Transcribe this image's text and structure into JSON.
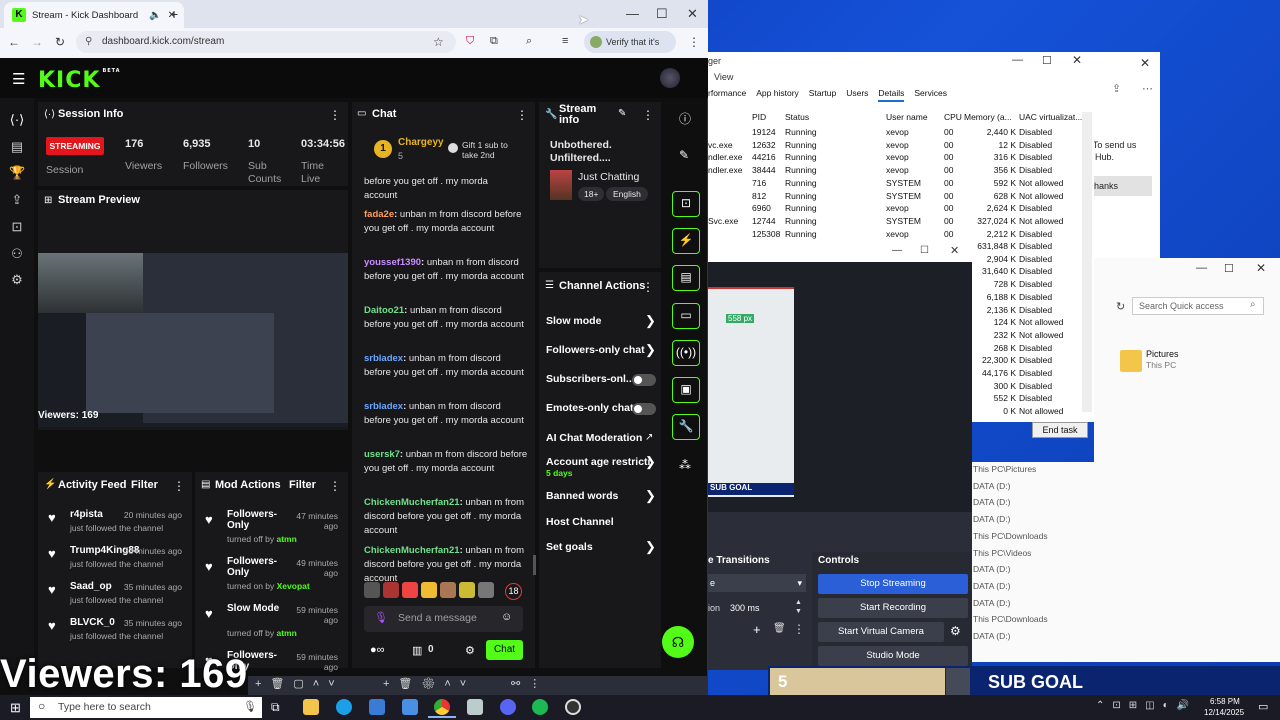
{
  "browser": {
    "tab_title": "Stream - Kick Dashboard",
    "url": "dashboard.kick.com/stream",
    "verify_label": "Verify that it's you"
  },
  "kick": {
    "logo": "KICK",
    "logo_sup": "BETA",
    "session": {
      "title": "Session Info",
      "status_badge": "STREAMING",
      "status_label": "Session",
      "viewers_value": "176",
      "viewers_label": "Viewers",
      "followers_value": "6,935",
      "followers_label": "Followers",
      "subs_value": "10",
      "subs_label": "Sub Counts",
      "time_value": "03:34:56",
      "time_label": "Time Live"
    },
    "preview": {
      "title": "Stream Preview",
      "viewers_overlay": "Viewers: 169"
    },
    "chat": {
      "title": "Chat",
      "top_user": "Chargeyy",
      "top_badge": "1",
      "top_count": "5",
      "gift_text": "Gift 1 sub to take 2nd",
      "partial_line_1": "before you get off . my morda",
      "partial_line_2": "account",
      "messages": [
        {
          "user": "fada2e",
          "text": "unban m from discord before you get off . my morda account",
          "color": "#ff9d5c"
        },
        {
          "user": "youssef1390",
          "text": "unban m from discord before you get off . my morda account",
          "color": "#c98cff"
        },
        {
          "user": "Daitoo21",
          "text": "unban m from discord before you get off . my morda account",
          "color": "#6fe08a"
        },
        {
          "user": "srbladex",
          "text": "unban m from discord before you get off . my morda account",
          "color": "#6aa8ff"
        },
        {
          "user": "srbladex",
          "text": "unban m from discord before you get off . my morda account",
          "color": "#6aa8ff"
        },
        {
          "user": "usersk7",
          "text": "unban m from discord before you get off . my morda account",
          "color": "#6fe08a"
        },
        {
          "user": "ChickenMucherfan21",
          "text": "unban m from discord before you get off . my morda account",
          "color": "#6fe08a"
        },
        {
          "user": "ChickenMucherfan21",
          "text": "unban m from discord before you get off . my morda account",
          "color": "#6fe08a"
        }
      ],
      "emote_count": "18",
      "input_placeholder": "Send a message",
      "points": "0",
      "send_label": "Chat"
    },
    "stream_info": {
      "title": "Stream info",
      "stream_title": "Unbothered. Unfiltered....",
      "category": "Just Chatting",
      "tag_age": "18+",
      "tag_lang": "English"
    },
    "channel_actions": {
      "title": "Channel Actions",
      "items": [
        {
          "label": "Slow mode",
          "kind": "chevron"
        },
        {
          "label": "Followers-only chat",
          "kind": "chevron"
        },
        {
          "label": "Subscribers-onl...",
          "kind": "toggle"
        },
        {
          "label": "Emotes-only chat",
          "kind": "toggle"
        },
        {
          "label": "AI Chat Moderation",
          "kind": "external"
        },
        {
          "label": "Account age restricti",
          "kind": "chevron",
          "sub": "5 days"
        },
        {
          "label": "Banned words",
          "kind": "chevron"
        },
        {
          "label": "Host Channel",
          "kind": "none"
        },
        {
          "label": "Set goals",
          "kind": "chevron"
        }
      ]
    },
    "activity_feed": {
      "title": "Activity Feed",
      "filter_label": "Filter",
      "items": [
        {
          "user": "r4pista",
          "time": "20 minutes ago",
          "action": "just followed the channel"
        },
        {
          "user": "Trump4King88",
          "time": "33 minutes ago",
          "action": "just followed the channel"
        },
        {
          "user": "Saad_op",
          "time": "35 minutes ago",
          "action": "just followed the channel"
        },
        {
          "user": "BLVCK_0",
          "time": "35 minutes ago",
          "action": "just followed the channel"
        }
      ]
    },
    "mod_actions": {
      "title": "Mod Actions",
      "filter_label": "Filter",
      "items": [
        {
          "title": "Followers-Only",
          "time": "47 minutes ago",
          "action": "turned off by",
          "by": "atmn"
        },
        {
          "title": "Followers-Only",
          "time": "49 minutes ago",
          "action": "turned on by",
          "by": "Xevopat"
        },
        {
          "title": "Slow Mode",
          "time": "59 minutes ago",
          "action": "turned off by",
          "by": "atmn"
        },
        {
          "title": "Followers-Only",
          "time": "59 minutes ago",
          "action": "",
          "by": ""
        }
      ]
    }
  },
  "task_manager": {
    "menu_view": "View",
    "tabs": [
      "rformance",
      "App history",
      "Startup",
      "Users",
      "Details",
      "Services"
    ],
    "columns": [
      "PID",
      "Status",
      "User name",
      "CPU",
      "Memory (a...",
      "UAC virtualizat..."
    ],
    "rows": [
      {
        "name": "",
        "pid": "19124",
        "status": "Running",
        "user": "xevop",
        "cpu": "00",
        "mem": "2,440 K",
        "uac": "Disabled"
      },
      {
        "name": "vc.exe",
        "pid": "12632",
        "status": "Running",
        "user": "xevop",
        "cpu": "00",
        "mem": "12 K",
        "uac": "Disabled"
      },
      {
        "name": "ndler.exe",
        "pid": "44216",
        "status": "Running",
        "user": "xevop",
        "cpu": "00",
        "mem": "316 K",
        "uac": "Disabled"
      },
      {
        "name": "ndler.exe",
        "pid": "38444",
        "status": "Running",
        "user": "xevop",
        "cpu": "00",
        "mem": "356 K",
        "uac": "Disabled"
      },
      {
        "name": "",
        "pid": "716",
        "status": "Running",
        "user": "SYSTEM",
        "cpu": "00",
        "mem": "592 K",
        "uac": "Not allowed"
      },
      {
        "name": "",
        "pid": "812",
        "status": "Running",
        "user": "SYSTEM",
        "cpu": "00",
        "mem": "628 K",
        "uac": "Not allowed"
      },
      {
        "name": "",
        "pid": "6960",
        "status": "Running",
        "user": "xevop",
        "cpu": "00",
        "mem": "2,624 K",
        "uac": "Disabled"
      },
      {
        "name": "Svc.exe",
        "pid": "12744",
        "status": "Running",
        "user": "SYSTEM",
        "cpu": "00",
        "mem": "327,024 K",
        "uac": "Not allowed"
      },
      {
        "name": "",
        "pid": "125308",
        "status": "Running",
        "user": "xevop",
        "cpu": "00",
        "mem": "2,212 K",
        "uac": "Disabled"
      }
    ],
    "extra_rows": [
      {
        "mem": "631,848 K",
        "uac": "Disabled"
      },
      {
        "mem": "2,904 K",
        "uac": "Disabled"
      },
      {
        "mem": "31,640 K",
        "uac": "Disabled"
      },
      {
        "mem": "728 K",
        "uac": "Disabled"
      },
      {
        "mem": "6,188 K",
        "uac": "Disabled"
      },
      {
        "mem": "2,136 K",
        "uac": "Disabled"
      },
      {
        "mem": "124 K",
        "uac": "Not allowed"
      },
      {
        "mem": "232 K",
        "uac": "Not allowed"
      },
      {
        "mem": "268 K",
        "uac": "Disabled"
      },
      {
        "mem": "22,300 K",
        "uac": "Disabled"
      },
      {
        "mem": "44,176 K",
        "uac": "Disabled"
      },
      {
        "mem": "300 K",
        "uac": "Disabled"
      },
      {
        "mem": "552 K",
        "uac": "Disabled"
      },
      {
        "mem": "0 K",
        "uac": "Not allowed"
      }
    ],
    "end_task": "End task"
  },
  "notice": {
    "line1": ". To send us",
    "line2": "k Hub.",
    "button": "hanks"
  },
  "explorer": {
    "search_placeholder": "Search Quick access",
    "pictures_title": "Pictures",
    "pictures_sub": "This PC",
    "paths": [
      "This PC\\Pictures",
      "DATA (D:)",
      "DATA (D:)",
      "DATA (D:)",
      "This PC\\Downloads",
      "This PC\\Videos",
      "DATA (D:)",
      "DATA (D:)",
      "DATA (D:)",
      "This PC\\Downloads",
      "DATA (D:)"
    ]
  },
  "obs": {
    "preview_label": "SUB GOAL",
    "preview_number": "558 px",
    "transitions_title": "e Transitions",
    "duration_label": "ion",
    "duration_value": "300 ms",
    "controls_title": "Controls",
    "buttons": [
      "Stop Streaming",
      "Start Recording",
      "Start Virtual Camera",
      "Studio Mode"
    ]
  },
  "overlay": {
    "viewers": "Viewers: 169",
    "subgoal_count": "5",
    "subgoal_label": "SUB GOAL"
  },
  "taskbar": {
    "search_placeholder": "Type here to search",
    "time": "6:58 PM",
    "date": "12/14/2025"
  }
}
